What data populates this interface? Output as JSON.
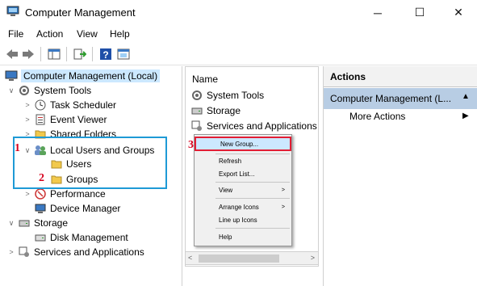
{
  "window": {
    "title": "Computer Management",
    "controls": [
      "─",
      "☐",
      "✕"
    ]
  },
  "menu": [
    "File",
    "Action",
    "View",
    "Help"
  ],
  "toolbar": {
    "buttons": [
      "back-icon",
      "forward-icon",
      "show-hide-tree-icon",
      "export-list-icon",
      "help-icon",
      "console-tree-icon"
    ]
  },
  "tree": {
    "root": "Computer Management (Local)",
    "system_tools": "System Tools",
    "task_scheduler": "Task Scheduler",
    "event_viewer": "Event Viewer",
    "shared_folders": "Shared Folders",
    "local_users_groups": "Local Users and Groups",
    "users": "Users",
    "groups": "Groups",
    "performance": "Performance",
    "device_manager": "Device Manager",
    "storage": "Storage",
    "disk_management": "Disk Management",
    "services_apps": "Services and Applications"
  },
  "list": {
    "header": "Name",
    "items": [
      "System Tools",
      "Storage",
      "Services and Applications"
    ]
  },
  "context_menu": {
    "new_group": "New Group...",
    "refresh": "Refresh",
    "export_list": "Export List...",
    "view": "View",
    "arrange_icons": "Arrange Icons",
    "line_up_icons": "Line up Icons",
    "help": "Help"
  },
  "actions": {
    "header": "Actions",
    "group": "Computer Management (L...",
    "more": "More Actions"
  },
  "annotations": {
    "step1": "1",
    "step2": "2",
    "step3": "3"
  },
  "colors": {
    "selection": "#cce8ff",
    "actions_group": "#b8cde4",
    "annotation_red": "#d6001c",
    "annotation_blue": "#1e9ad6"
  }
}
